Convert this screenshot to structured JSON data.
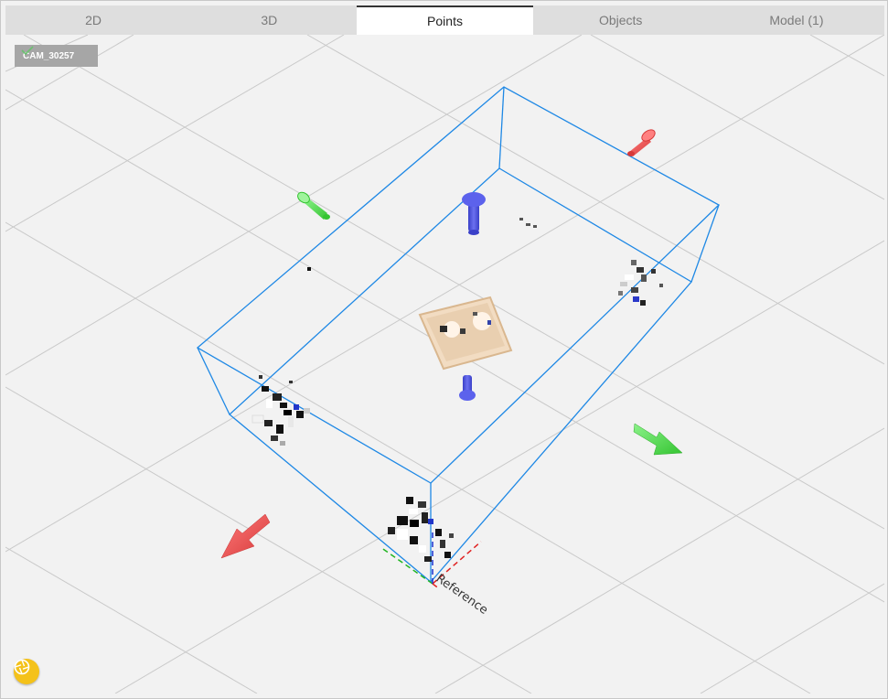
{
  "tabs": [
    {
      "label": "2D",
      "active": false
    },
    {
      "label": "3D",
      "active": false
    },
    {
      "label": "Points",
      "active": true
    },
    {
      "label": "Objects",
      "active": false
    },
    {
      "label": "Model (1)",
      "active": false
    }
  ],
  "camera": {
    "name": "CAM_30257",
    "status_icon": "check-icon"
  },
  "scene": {
    "reference_label": "Reference",
    "box_color": "#1e88e5",
    "grid_color": "#c9c9c9",
    "arrow_colors": {
      "x_axis": "#e8494b",
      "y_axis": "#4fd64a",
      "z_axis": "#4a50e0"
    }
  },
  "snapshot_button": {
    "icon": "aperture-icon",
    "color": "#f4c21a"
  }
}
